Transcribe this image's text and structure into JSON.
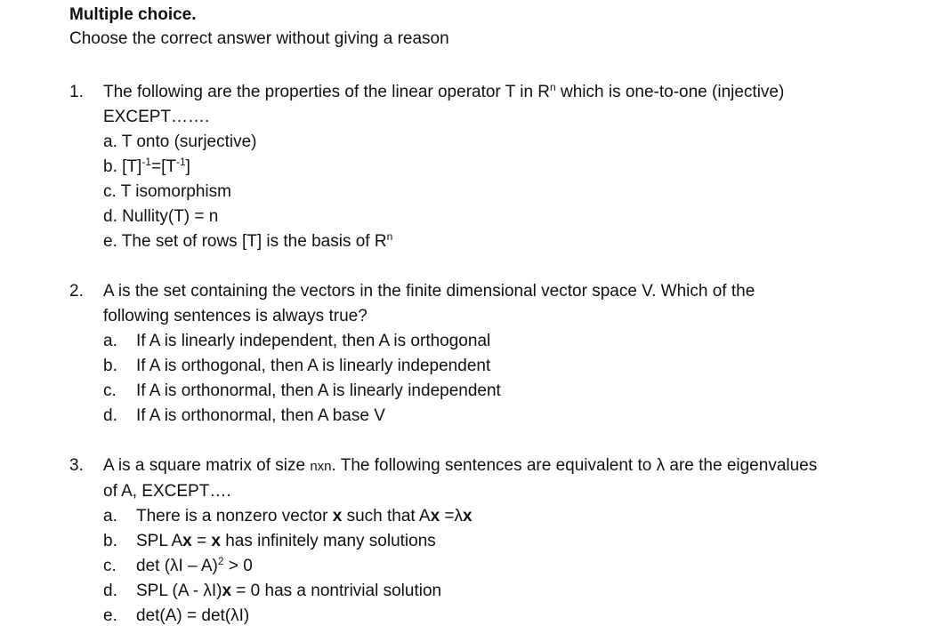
{
  "header": {
    "title": "Multiple choice.",
    "instruction": "Choose the correct answer without giving a reason"
  },
  "questions": [
    {
      "number": "1.",
      "text": "The following are the properties of the linear operator T in R",
      "text_sup": "n",
      "text_after": " which is one-to-one (injective)",
      "continuation": "EXCEPT…….",
      "options": [
        {
          "letter": "a.",
          "text": "T onto (surjective)"
        },
        {
          "letter": "b.",
          "text_parts": [
            "[T]",
            "-1",
            "=[T",
            "-1",
            "]"
          ]
        },
        {
          "letter": "c.",
          "text": "T isomorphism"
        },
        {
          "letter": "d.",
          "text": "Nullity(T) = n"
        },
        {
          "letter": "e.",
          "text": "The set of rows [T] is the basis of R",
          "sup": "n"
        }
      ]
    },
    {
      "number": "2.",
      "text": "A is the set containing the vectors in the finite dimensional vector space V. Which of the",
      "continuation": "following sentences is always true?",
      "options": [
        {
          "letter": "a.",
          "text": "If A is linearly independent, then A is orthogonal"
        },
        {
          "letter": "b.",
          "text": "If A is orthogonal, then A is linearly independent"
        },
        {
          "letter": "c.",
          "text": "If A is orthonormal, then A is linearly independent"
        },
        {
          "letter": "d.",
          "text": "If A is orthonormal, then A base V"
        }
      ]
    },
    {
      "number": "3.",
      "text_parts": [
        "A is a square matrix of size ",
        "nxn",
        ". The following sentences are equivalent to λ are the eigenvalues"
      ],
      "continuation": "of A, EXCEPT….",
      "options": [
        {
          "letter": "a.",
          "text_parts": [
            "There is a nonzero vector ",
            "x",
            " such that A",
            "x",
            " =λ",
            "x"
          ]
        },
        {
          "letter": "b.",
          "text_parts": [
            "SPL A",
            "x",
            " = ",
            "x",
            " has infinitely many solutions"
          ]
        },
        {
          "letter": "c.",
          "text_parts": [
            "det (λI – A)",
            "2",
            " > 0"
          ]
        },
        {
          "letter": "d.",
          "text_parts": [
            "SPL (A - λI)",
            "x",
            " = 0 has a nontrivial solution"
          ]
        },
        {
          "letter": "e.",
          "text": "det(A) = det(λI)"
        }
      ]
    }
  ]
}
